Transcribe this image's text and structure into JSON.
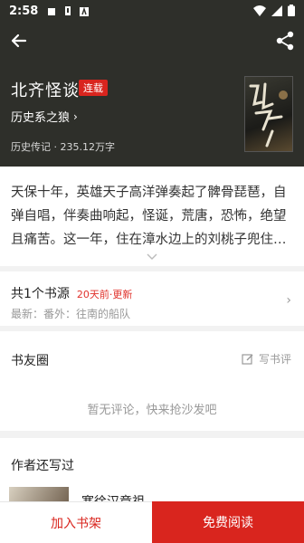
{
  "status_bar": {
    "time": "2:58"
  },
  "book": {
    "title": "北齐怪谈",
    "status": "连载",
    "author": "历史系之狼",
    "meta": "历史传记 · 235.12万字"
  },
  "description": "天保十年，英雄天子高洋弹奏起了髀骨琵琶，自弹自唱，伴奏曲响起，怪诞，荒唐，恐怖，绝望且痛苦。这一年，住在漳水边上的刘桃子兜住…",
  "sources": {
    "count_label": "共1个书源",
    "updated": "20天前·更新",
    "latest": "最新：番外：往南的船队"
  },
  "circle": {
    "title": "书友圈",
    "write_label": "写书评",
    "empty": "暂无评论，快来抢沙发吧"
  },
  "author_books": {
    "title": "作者还写过",
    "first_book": "寒徐汉章祖"
  },
  "actions": {
    "add_shelf": "加入书架",
    "read_free": "免费阅读"
  },
  "colors": {
    "accent": "#d9251e",
    "header_bg": "#2e2f2a"
  }
}
